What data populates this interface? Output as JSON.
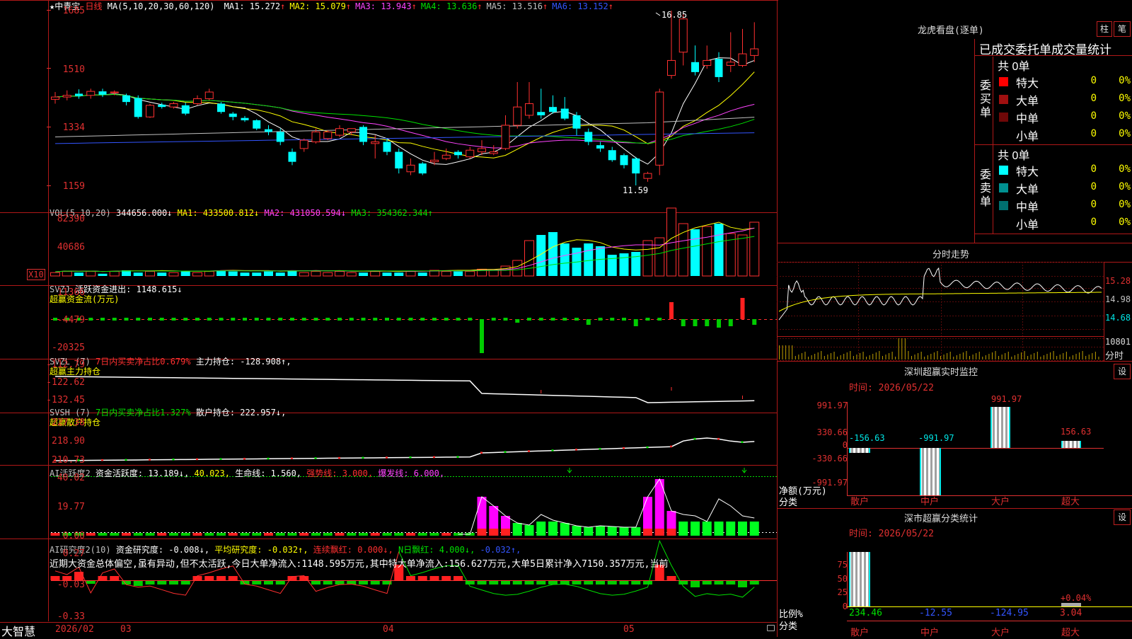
{
  "main": {
    "stock_name": "★中青宝",
    "period": "日线",
    "ma_label": "MA(5,10,20,30,60,120)",
    "ma": [
      {
        "label": "MA1: 15.272",
        "arrow": "↑",
        "color": "#ffffff"
      },
      {
        "label": "MA2: 15.079",
        "arrow": "↑",
        "color": "#ffff00"
      },
      {
        "label": "MA3: 13.943",
        "arrow": "↑",
        "color": "#ff44ff"
      },
      {
        "label": "MA4: 13.636",
        "arrow": "↑",
        "color": "#00e000"
      },
      {
        "label": "MA5: 13.516",
        "arrow": "↑",
        "color": "#c0c0c0"
      },
      {
        "label": "MA6: 13.152",
        "arrow": "↑",
        "color": "#3355ff"
      }
    ],
    "y_ticks": [
      "1685",
      "1510",
      "1334",
      "1159"
    ],
    "high_label": "16.85",
    "low_label": "11.59"
  },
  "vol": {
    "header": "VOL(5,10,20)",
    "value": "344656.000↓",
    "ma1": "MA1: 433500.812↓",
    "ma2": "MA2: 431050.594↓",
    "ma3": "MA3: 354362.344↑",
    "y_ticks": [
      "82390",
      "40686"
    ],
    "unit": "X10"
  },
  "svzj": {
    "header": "SVZJ",
    "label": "活跃资金进出: 1148.615↓",
    "sub": "超赢资金流(万元)",
    "y_ticks": [
      "11366",
      "-4479",
      "-20325"
    ]
  },
  "svzl": {
    "header": "SVZL (7)",
    "ratio": "7日内买卖净占比0.679%",
    "label": "主力持仓: -128.908↑,",
    "sub": "超赢主力持仓",
    "y_ticks": [
      "-112.79",
      "-122.62",
      "-132.45"
    ]
  },
  "svsh": {
    "header": "SVSH (7)",
    "ratio": "7日内买卖净占比1.327%",
    "label": "散户持仓: 222.957↓,",
    "sub": "超赢散户持仓",
    "y_ticks": [
      "227.38",
      "218.90",
      "210.73"
    ]
  },
  "ai_active": {
    "header": "AI活跃度2",
    "a": "资金活跃度: 13.189↓,",
    "b": "40.023,",
    "c": "生命线: 1.560,",
    "d": "强势线: 3.000,",
    "e": "爆发线: 6.000,",
    "y_ticks": [
      "40.02",
      "19.77",
      "0.00"
    ]
  },
  "ai_research": {
    "header": "AI研究度2(10)",
    "a": "资金研究度: -0.008↓,",
    "b": "平均研究度: -0.032↑,",
    "c": "连续飘红: 0.000↓,",
    "d": "N日飘红: 4.000↓,",
    "e": "-0.032↑,",
    "text": "近期大资金总体偏空,虽有异动,但不太活跃,今日大单净流入:1148.595万元,其中特大单净流入:156.627万元,大单5日累计净入7150.357万元,当前",
    "y_ticks": [
      "0.27",
      "-0.03",
      "-0.33"
    ]
  },
  "footer": {
    "brand": "大智慧",
    "dates": [
      "2026/02",
      "03",
      "04",
      "05"
    ]
  },
  "lhb": {
    "title": "龙虎看盘(逐单)",
    "btn1": "柱",
    "btn2": "笔",
    "tabs": "已成交委托单成交量统计",
    "buy_label": "委买单",
    "sell_label": "委卖单",
    "buy_total": "共 0单",
    "sell_total": "共 0单",
    "buy_rows": [
      {
        "name": "特大",
        "v": "0",
        "p": "0%",
        "color": "#ff0000"
      },
      {
        "name": "大单",
        "v": "0",
        "p": "0%",
        "color": "#a01010"
      },
      {
        "name": "中单",
        "v": "0",
        "p": "0%",
        "color": "#700808"
      },
      {
        "name": "小单",
        "v": "0",
        "p": "0%",
        "color": "#000000"
      }
    ],
    "sell_rows": [
      {
        "name": "特大",
        "v": "0",
        "p": "0%",
        "color": "#00ffff"
      },
      {
        "name": "大单",
        "v": "0",
        "p": "0%",
        "color": "#009090"
      },
      {
        "name": "中单",
        "v": "0",
        "p": "0%",
        "color": "#007070"
      },
      {
        "name": "小单",
        "v": "0",
        "p": "0%",
        "color": "#000000"
      }
    ]
  },
  "intraday": {
    "title": "分时走势",
    "y_ticks": [
      "15.28",
      "14.98",
      "14.68"
    ],
    "vol_tick": "10801",
    "vol_label": "分时"
  },
  "sz_monitor": {
    "title": "深圳超赢实时监控",
    "btn": "设",
    "time": "时间: 2026/05/22",
    "y_ticks": [
      "991.97",
      "330.66",
      "0",
      "-330.66",
      "-991.97"
    ],
    "axis_unit": "净额(万元)",
    "axis_cat": "分类",
    "categories": [
      "散户",
      "中户",
      "大户",
      "超大"
    ],
    "values": [
      -156.63,
      -991.97,
      991.97,
      156.63
    ],
    "labels": [
      "-156.63",
      "-991.97",
      "991.97",
      "156.63"
    ]
  },
  "sz_class": {
    "title": "深市超赢分类统计",
    "btn": "设",
    "time": "时间: 2026/05/22",
    "y_ticks": [
      "75",
      "50",
      "25",
      "0"
    ],
    "axis_unit": "比例%",
    "axis_cat": "分类",
    "categories": [
      "散户",
      "中户",
      "大户",
      "超大"
    ],
    "values": [
      "234.46",
      "-12.55",
      "-124.95",
      "3.04"
    ],
    "extra": "+0.04%"
  }
}
